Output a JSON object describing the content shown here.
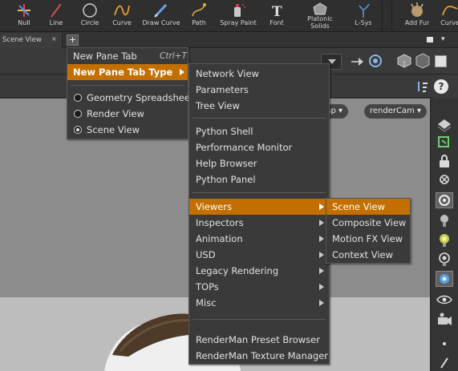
{
  "shelf": {
    "tools": [
      {
        "label": "Null",
        "icon": "null-icon"
      },
      {
        "label": "Line",
        "icon": "line-icon"
      },
      {
        "label": "Circle",
        "icon": "circle-icon"
      },
      {
        "label": "Curve",
        "icon": "curve-icon"
      },
      {
        "label": "Draw Curve",
        "icon": "draw-curve-icon"
      },
      {
        "label": "Path",
        "icon": "path-icon"
      },
      {
        "label": "Spray Paint",
        "icon": "spray-paint-icon"
      },
      {
        "label": "Font",
        "icon": "font-icon"
      },
      {
        "label": "Platonic Solids",
        "icon": "platonic-solids-icon"
      },
      {
        "label": "L-Sys",
        "icon": "l-system-icon"
      },
      {
        "label": "Add Fur",
        "icon": "add-fur-icon"
      },
      {
        "label": "Curve",
        "icon": "curve-icon"
      }
    ]
  },
  "tabbar": {
    "active_tab": "Scene View",
    "close_glyph": "×",
    "add_glyph": "+"
  },
  "viewport": {
    "camera_persp": "ersp",
    "camera_render": "renderCam"
  },
  "menu_main": {
    "items": [
      {
        "label": "New Pane Tab",
        "shortcut": "Ctrl+T"
      },
      {
        "label": "New Pane Tab Type"
      }
    ],
    "radios": [
      {
        "label": "Geometry Spreadsheet",
        "checked": false
      },
      {
        "label": "Render View",
        "checked": false
      },
      {
        "label": "Scene View",
        "checked": true
      }
    ]
  },
  "menu_types": {
    "group1": [
      "Network View",
      "Parameters",
      "Tree View"
    ],
    "group2": [
      "Python Shell",
      "Performance Monitor",
      "Help Browser",
      "Python Panel"
    ],
    "group3": [
      "Viewers",
      "Inspectors",
      "Animation",
      "USD",
      "Legacy Rendering",
      "TOPs",
      "Misc"
    ],
    "group4": [
      "RenderMan Preset Browser",
      "RenderMan Texture Manager"
    ]
  },
  "menu_viewers": {
    "items": [
      "Scene View",
      "Composite View",
      "Motion FX View",
      "Context View"
    ]
  },
  "colors": {
    "highlight": "#c26f00",
    "menu_bg": "#3a3a3a"
  }
}
